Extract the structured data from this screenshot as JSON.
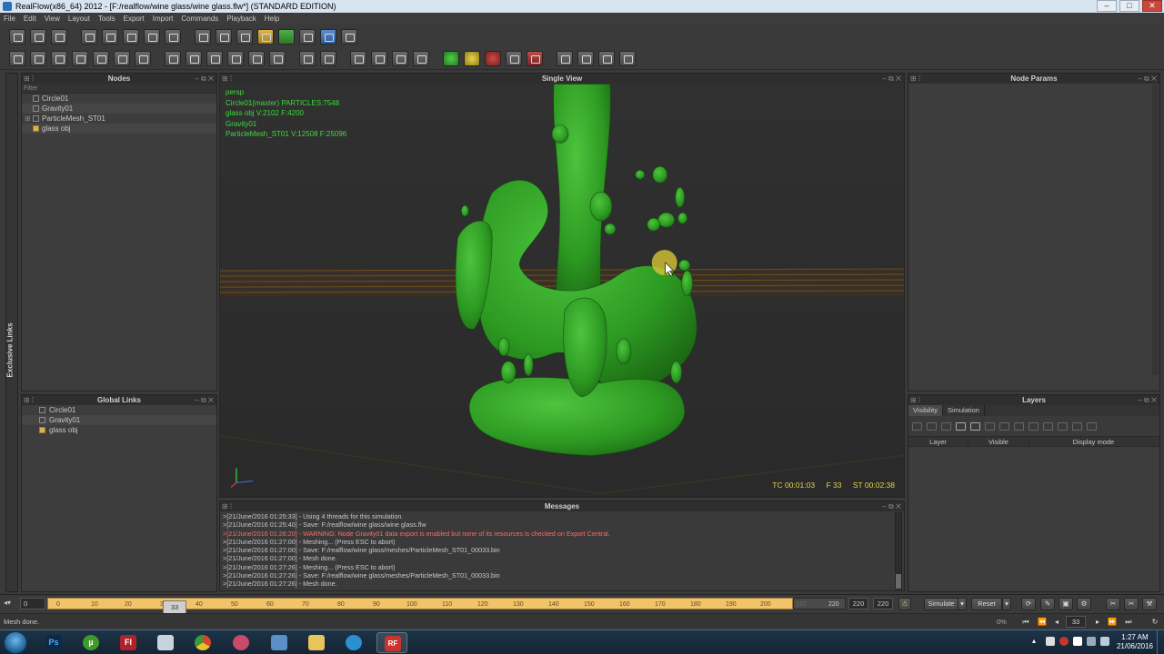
{
  "window": {
    "title": "RealFlow(x86_64) 2012 - [F:/realflow/wine glass/wine glass.flw*] (STANDARD EDITION)",
    "buttons": [
      "–",
      "□",
      "✕"
    ]
  },
  "menu": [
    "File",
    "Edit",
    "View",
    "Layout",
    "Tools",
    "Export",
    "Import",
    "Commands",
    "Playback",
    "Help"
  ],
  "nodes_panel": {
    "title": "Nodes",
    "filter": "Filter",
    "items": [
      "Circle01",
      "Gravity01",
      "ParticleMesh_ST01",
      "glass obj"
    ]
  },
  "global_links_panel": {
    "title": "Global Links",
    "items": [
      "Circle01",
      "Gravity01",
      "glass obj"
    ]
  },
  "side_tab": {
    "label": "Exclusive Links"
  },
  "viewport": {
    "title": "Single View",
    "hud": [
      "persp",
      "Circle01(master) PARTICLES:7548",
      "glass obj V:2102 F:4200",
      "Gravity01",
      "ParticleMesh_ST01 V:12508 F:25096"
    ],
    "timecode": {
      "tc": "TC 00:01:03",
      "frame": "F 33",
      "st": "ST 00:02:38"
    },
    "colors": {
      "fluid": "#2f9a23",
      "grid": "#8a5a1a",
      "hud_text": "#3adb3a",
      "timecode": "#e4d24a"
    }
  },
  "messages_panel": {
    "title": "Messages",
    "lines": [
      {
        "text": ">[21/June/2016 01:25:33] - Using 4 threads for this simulation.",
        "warn": false
      },
      {
        "text": ">[21/June/2016 01:25:40] - Save: F:/realflow/wine glass/wine glass.flw",
        "warn": false
      },
      {
        "text": ">[21/June/2016 01:26:20] - WARNING: Node Gravity01 data export is enabled but none of its resources is checked on Export Central.",
        "warn": true
      },
      {
        "text": ">[21/June/2016 01:27:00] - Meshing... (Press ESC to abort)",
        "warn": false
      },
      {
        "text": ">[21/June/2016 01:27:00] - Save: F:/realflow/wine glass/meshes/ParticleMesh_ST01_00033.bin",
        "warn": false
      },
      {
        "text": ">[21/June/2016 01:27:00] - Mesh done.",
        "warn": false
      },
      {
        "text": ">[21/June/2016 01:27:26] - Meshing... (Press ESC to abort)",
        "warn": false
      },
      {
        "text": ">[21/June/2016 01:27:26] - Save: F:/realflow/wine glass/meshes/ParticleMesh_ST01_00033.bin",
        "warn": false
      },
      {
        "text": ">[21/June/2016 01:27:26] - Mesh done.",
        "warn": false
      }
    ]
  },
  "node_params_panel": {
    "title": "Node Params"
  },
  "layers_panel": {
    "title": "Layers",
    "tabs": [
      "Visibility",
      "Simulation"
    ],
    "columns": [
      "Layer",
      "Visible",
      "Display mode"
    ]
  },
  "timeline": {
    "start": "0",
    "current": "33",
    "end_label": "220",
    "range_end": "220",
    "total_end": "220",
    "ticks": [
      "0",
      "10",
      "20",
      "30",
      "40",
      "50",
      "60",
      "70",
      "80",
      "90",
      "100",
      "110",
      "120",
      "130",
      "140",
      "150",
      "160",
      "170",
      "180",
      "190",
      "200",
      "210"
    ],
    "simulate_label": "Simulate",
    "reset_label": "Reset"
  },
  "status": {
    "text": "Mesh done.",
    "progress": "0%",
    "frame": "33"
  },
  "taskbar": {
    "apps": [
      {
        "name": "photoshop",
        "glyph": "Ps",
        "color": "#0b2a4a"
      },
      {
        "name": "utorrent",
        "glyph": "µ",
        "color": "#3e9a2a"
      },
      {
        "name": "flash",
        "glyph": "Fl",
        "color": "#b0222a"
      },
      {
        "name": "notepad",
        "glyph": "",
        "color": "#c8d3de"
      },
      {
        "name": "chrome",
        "glyph": "",
        "color": "#d9a52b"
      },
      {
        "name": "tool",
        "glyph": "",
        "color": "#c94a6a"
      },
      {
        "name": "monitor",
        "glyph": "",
        "color": "#5b8fc5"
      },
      {
        "name": "explorer",
        "glyph": "",
        "color": "#e8c45a"
      },
      {
        "name": "camera",
        "glyph": "",
        "color": "#2c8fd0"
      },
      {
        "name": "realflow",
        "glyph": "RF",
        "color": "#c9342e"
      }
    ],
    "time": "1:27 AM",
    "date": "21/06/2016"
  }
}
